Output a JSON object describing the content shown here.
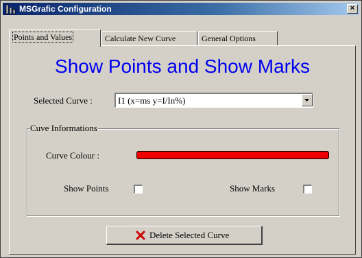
{
  "window": {
    "title": "MSGrafic Configuration",
    "close_glyph": "×"
  },
  "tabs": [
    {
      "label": "Points and Values",
      "active": true
    },
    {
      "label": "Calculate New Curve",
      "active": false
    },
    {
      "label": "General Options",
      "active": false
    }
  ],
  "page": {
    "heading": "Show Points and Show Marks"
  },
  "selected_curve": {
    "label": "Selected Curve :",
    "value": "I1 (x=ms y=I/In%)"
  },
  "curve_info": {
    "group_title": "Cuve Informations",
    "colour_label": "Curve  Colour :",
    "colour": "#ee0000",
    "show_points_label": "Show Points",
    "show_points_checked": false,
    "show_marks_label": "Show Marks",
    "show_marks_checked": false
  },
  "delete_button": {
    "label": "Delete Selected Curve",
    "icon": "red-x-icon"
  },
  "colors": {
    "heading": "#0000ee",
    "titlebar_start": "#0a246a",
    "titlebar_end": "#a6caf0",
    "face": "#d4d0c8"
  }
}
